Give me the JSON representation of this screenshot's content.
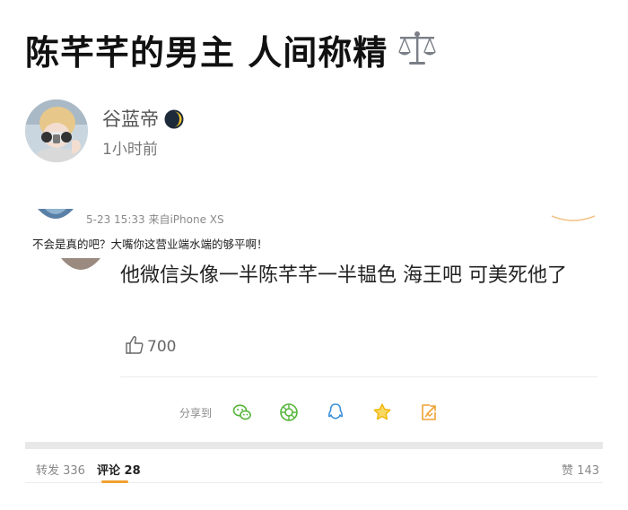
{
  "post": {
    "title": "陈芊芊的男主 人间称精",
    "title_emoji": "scale-icon",
    "author": {
      "name": "谷蓝帝",
      "badge": "moon-icon",
      "time": "1小时前"
    }
  },
  "screenshot": {
    "meta": "5-23 15:33  来自iPhone XS",
    "post_text": "不会是真的吧？大嘴你这营业端水端的够平啊！",
    "comment": "他微信头像一半陈芊芊一半韫色 海王吧 可美死他了",
    "likes": "700",
    "share_label": "分享到",
    "share_icons": [
      "wechat-icon",
      "moments-icon",
      "qq-icon",
      "favorite-icon",
      "export-icon"
    ]
  },
  "tabs": {
    "repost": "转发 336",
    "comments": "评论 28",
    "likes": "赞 143"
  },
  "colors": {
    "accent": "#f0a131",
    "share_icon": "#55b53a",
    "qq_icon": "#3b8fd9",
    "star_icon": "#f0b400",
    "text_muted": "#888888"
  }
}
